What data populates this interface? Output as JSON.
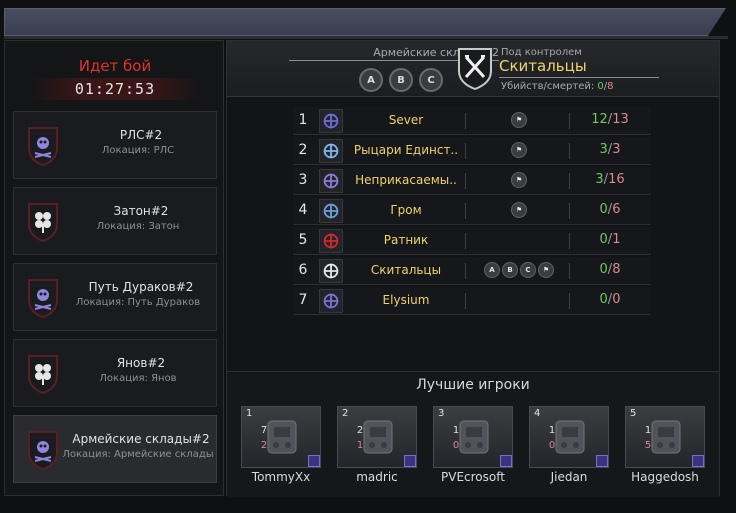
{
  "battle": {
    "status": "Идет бой",
    "timer": "01:27:53"
  },
  "locations": [
    {
      "name": "РЛС#2",
      "location": "Локация: РЛС",
      "emblem": "skull-emblem",
      "selected": false
    },
    {
      "name": "Затон#2",
      "location": "Локация: Затон",
      "emblem": "clover-emblem",
      "selected": false
    },
    {
      "name": "Путь Дураков#2",
      "location": "Локация: Путь Дураков",
      "emblem": "skull-emblem",
      "selected": false
    },
    {
      "name": "Янов#2",
      "location": "Локация: Янов",
      "emblem": "clover-emblem",
      "selected": false
    },
    {
      "name": "Армейские склады#2",
      "location": "Локация: Армейские склады",
      "emblem": "skull-emblem",
      "selected": true
    }
  ],
  "header": {
    "target_name": "Армейские склады#2",
    "points": [
      "A",
      "B",
      "C"
    ],
    "control_label": "Под контролем",
    "control_faction": "Скитальцы",
    "kd_label": "Убийств/смертей:",
    "kd_kills": "0",
    "kd_deaths": "8"
  },
  "factions": [
    {
      "rank": "1",
      "name": "Sever",
      "points": [
        "flag"
      ],
      "kills": "12",
      "deaths": "13",
      "emblem_color": "#6e6cd8"
    },
    {
      "rank": "2",
      "name": "Рыцари Единст..",
      "points": [
        "flag"
      ],
      "kills": "3",
      "deaths": "3",
      "emblem_color": "#7fb8e8"
    },
    {
      "rank": "3",
      "name": "Неприкасаемы..",
      "points": [
        "flag"
      ],
      "kills": "3",
      "deaths": "16",
      "emblem_color": "#8f7ad8"
    },
    {
      "rank": "4",
      "name": "Гром",
      "points": [
        "flag"
      ],
      "kills": "0",
      "deaths": "6",
      "emblem_color": "#6aa0d8"
    },
    {
      "rank": "5",
      "name": "Ратник",
      "points": [],
      "kills": "0",
      "deaths": "1",
      "emblem_color": "#d22a2a"
    },
    {
      "rank": "6",
      "name": "Скитальцы",
      "points": [
        "A",
        "B",
        "C",
        "flag"
      ],
      "kills": "0",
      "deaths": "8",
      "emblem_color": "#e6e6e6"
    },
    {
      "rank": "7",
      "name": "Elysium",
      "points": [],
      "kills": "0",
      "deaths": "0",
      "emblem_color": "#7a72d8"
    }
  ],
  "best_players": {
    "title": "Лучшие игроки",
    "players": [
      {
        "rank": "1",
        "name": "TommyXx",
        "kills": "7",
        "deaths": "2"
      },
      {
        "rank": "2",
        "name": "madric",
        "kills": "2",
        "deaths": "1"
      },
      {
        "rank": "3",
        "name": "PVEcrosoft",
        "kills": "1",
        "deaths": "0"
      },
      {
        "rank": "4",
        "name": "Jiedan",
        "kills": "1",
        "deaths": "0"
      },
      {
        "rank": "5",
        "name": "Haggedosh",
        "kills": "1",
        "deaths": "5"
      }
    ]
  }
}
